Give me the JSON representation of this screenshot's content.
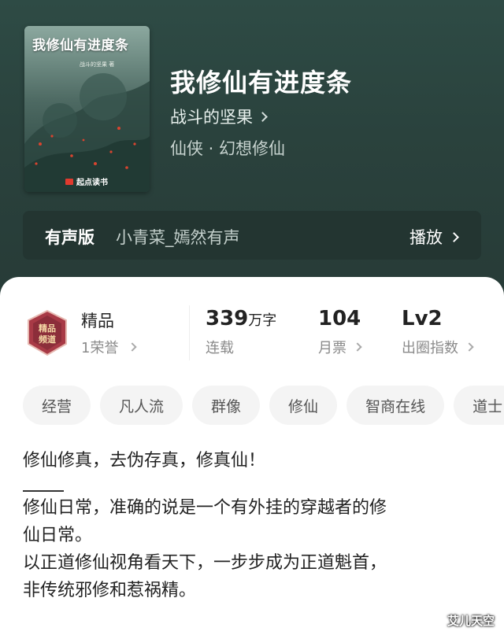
{
  "cover": {
    "title": "我修仙有进度条",
    "author_small": "战斗的坚果 著",
    "publisher": "起点读书"
  },
  "book": {
    "title": "我修仙有进度条",
    "author": "战斗的坚果",
    "genre": "仙侠 · 幻想修仙"
  },
  "audio": {
    "label": "有声版",
    "narrator": "小青菜_嫣然有声",
    "play": "播放"
  },
  "quality": {
    "label": "精品",
    "honor": "1荣誉"
  },
  "stats": {
    "words_value": "339",
    "words_unit": "万字",
    "words_label": "连载",
    "votes_value": "104",
    "votes_label": "月票",
    "level_value": "Lv2",
    "level_label": "出圈指数"
  },
  "tags": [
    "经营",
    "凡人流",
    "群像",
    "修仙",
    "智商在线",
    "道士"
  ],
  "intro": {
    "line1": "修仙修真，去伪存真，修真仙！",
    "line2": "修仙日常，准确的说是一个有外挂的穿越者的修",
    "line3": "仙日常。",
    "line4": "以正道修仙视角看天下，一步步成为正道魁首，",
    "line5": "非传统邪修和惹祸精。"
  },
  "watermark": "艾儿天空",
  "colors": {
    "header_bg": "#2e4b45",
    "audio_bar_bg": "#233531",
    "tag_bg": "#f4f4f4",
    "badge_red": "#a83a46"
  }
}
